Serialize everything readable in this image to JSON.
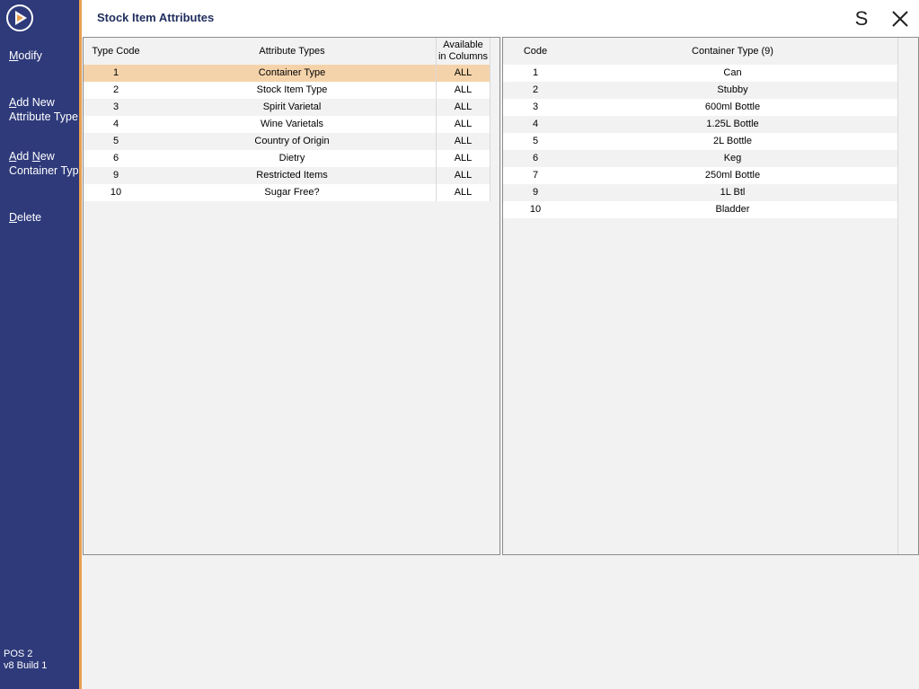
{
  "app": {
    "window_title": "Stock Item Attributes",
    "version_line1": "POS 2",
    "version_line2": "v8 Build 1"
  },
  "header": {
    "s_button_label": "S",
    "close_icon": "close-icon"
  },
  "sidebar": {
    "items": [
      {
        "mnemonic": "M",
        "rest": "odify",
        "line2": ""
      },
      {
        "mnemonic": "A",
        "rest": "dd New",
        "line2": "Attribute Type"
      },
      {
        "mnemonic": "A",
        "rest": "dd ",
        "mnemonic2": "N",
        "rest2": "ew",
        "line2": "Container Type"
      },
      {
        "mnemonic": "D",
        "rest": "elete",
        "line2": ""
      }
    ]
  },
  "attributes_table": {
    "headers": {
      "type_code": "Type Code",
      "attribute_types": "Attribute Types",
      "available_line1": "Available",
      "available_line2": "in Columns"
    },
    "selected_index": 0,
    "rows": [
      {
        "code": "1",
        "name": "Container Type",
        "available": "ALL"
      },
      {
        "code": "2",
        "name": "Stock Item Type",
        "available": "ALL"
      },
      {
        "code": "3",
        "name": "Spirit Varietal",
        "available": "ALL"
      },
      {
        "code": "4",
        "name": "Wine Varietals",
        "available": "ALL"
      },
      {
        "code": "5",
        "name": "Country of Origin",
        "available": "ALL"
      },
      {
        "code": "6",
        "name": "Dietry",
        "available": "ALL"
      },
      {
        "code": "9",
        "name": "Restricted Items",
        "available": "ALL"
      },
      {
        "code": "10",
        "name": "Sugar Free?",
        "available": "ALL"
      }
    ]
  },
  "container_table": {
    "headers": {
      "code": "Code",
      "container_type": "Container Type (9)"
    },
    "rows": [
      {
        "code": "1",
        "name": "Can"
      },
      {
        "code": "2",
        "name": "Stubby"
      },
      {
        "code": "3",
        "name": "600ml Bottle"
      },
      {
        "code": "4",
        "name": "1.25L Bottle"
      },
      {
        "code": "5",
        "name": "2L Bottle"
      },
      {
        "code": "6",
        "name": "Keg"
      },
      {
        "code": "7",
        "name": "250ml Bottle"
      },
      {
        "code": "9",
        "name": "1L Btl"
      },
      {
        "code": "10",
        "name": "Bladder"
      }
    ]
  },
  "colors": {
    "sidebar": "#2e3a7a",
    "accent": "#e8a050",
    "selected_row": "#f5d3aa",
    "title_text": "#1f2d5c"
  }
}
